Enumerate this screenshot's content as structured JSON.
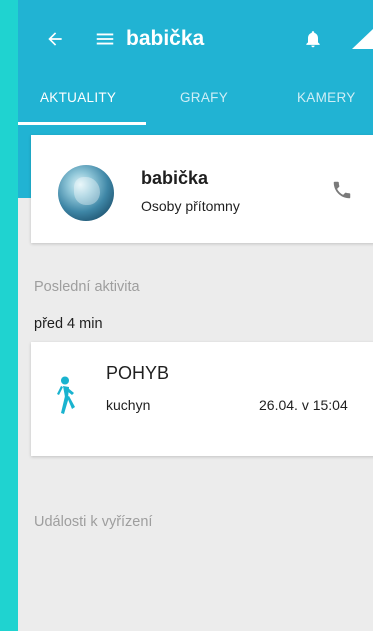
{
  "colors": {
    "primary": "#21b3d3",
    "accent": "#1fd3d0",
    "motion_icon": "#19b3cf",
    "background": "#ececec"
  },
  "toolbar": {
    "back_icon": "arrow-left-icon",
    "menu_icon": "hamburger-menu-icon",
    "title": "babička",
    "bell_icon": "bell-icon",
    "signal_icon": "signal-icon"
  },
  "tabs": [
    {
      "label": "AKTUALITY",
      "active": true
    },
    {
      "label": "GRAFY",
      "active": false
    },
    {
      "label": "KAMERY",
      "active": false
    }
  ],
  "person_card": {
    "name": "babička",
    "status": "Osoby přítomny",
    "phone_icon": "phone-icon"
  },
  "activity_section": {
    "heading": "Poslední aktivita",
    "time_ago": "před 4 min",
    "event": {
      "icon": "walking-person-icon",
      "type": "POHYB",
      "location": "kuchyn",
      "datetime": "26.04. v 15:04"
    }
  },
  "pending_section": {
    "heading": "Události k vyřízení"
  }
}
